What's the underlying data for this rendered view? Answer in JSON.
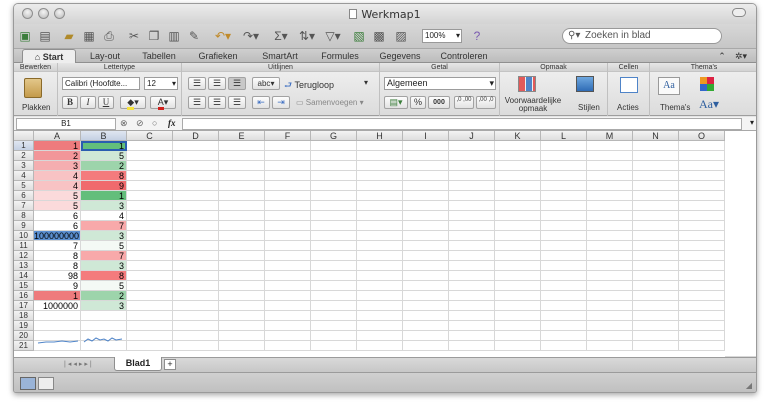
{
  "window": {
    "title": "Werkmap1"
  },
  "toolbar": {
    "zoom": "100%",
    "search_placeholder": "Zoeken in blad"
  },
  "tabs": [
    "Start",
    "Lay-out",
    "Tabellen",
    "Grafieken",
    "SmartArt",
    "Formules",
    "Gegevens",
    "Controleren"
  ],
  "ribbon": {
    "groups": {
      "bewerken": "Bewerken",
      "lettertype": "Lettertype",
      "uitlijnen": "Uitlijnen",
      "getal": "Getal",
      "opmaak": "Opmaak",
      "cellen": "Cellen",
      "themas": "Thema's"
    },
    "plakken": "Plakken",
    "font_name": "Calibri (Hoofdte...",
    "font_size": "12",
    "bold": "B",
    "italic": "I",
    "underline": "U",
    "wrap_text": "Terugloop",
    "merge": "Samenvoegen",
    "abc": "abc",
    "number_format": "Algemeen",
    "percent": "%",
    "thousands": "000",
    "dec_inc": ",0 ,00",
    "dec_dec": ",00 ,0",
    "cond_format": "Voorwaardelijke opmaak",
    "styles": "Stijlen",
    "actions": "Acties",
    "themes": "Thema's",
    "theme_sample": "Aa",
    "font_sample": "Aa"
  },
  "formula_bar": {
    "name_box": "B1",
    "fx": "fx",
    "content": ""
  },
  "grid": {
    "columns": [
      "A",
      "B",
      "C",
      "D",
      "E",
      "F",
      "G",
      "H",
      "I",
      "J",
      "K",
      "L",
      "M",
      "N",
      "O"
    ],
    "rows": [
      "1",
      "2",
      "3",
      "4",
      "5",
      "6",
      "7",
      "8",
      "9",
      "10",
      "11",
      "12",
      "13",
      "14",
      "15",
      "16",
      "17",
      "18",
      "19",
      "20",
      "21"
    ],
    "col_a": [
      "1",
      "2",
      "3",
      "4",
      "4",
      "5",
      "5",
      "6",
      "6",
      "100000000",
      "7",
      "8",
      "8",
      "98",
      "9",
      "1",
      "1000000",
      "",
      "",
      "",
      ""
    ],
    "col_b": [
      "1",
      "5",
      "2",
      "8",
      "9",
      "1",
      "3",
      "4",
      "7",
      "3",
      "5",
      "7",
      "3",
      "8",
      "5",
      "2",
      "3",
      "",
      "",
      "",
      ""
    ],
    "col_a_colors": [
      "#ee7b7d",
      "#f29699",
      "#f5aeb0",
      "#f8c3c4",
      "#f8c3c4",
      "#fbdadb",
      "#fbdadb",
      "#ffffff",
      "#ffffff",
      "#5b8fd1",
      "#ffffff",
      "#ffffff",
      "#ffffff",
      "#ffffff",
      "#ffffff",
      "#ee7b7d",
      "#ffffff",
      "#ffffff",
      "#ffffff",
      "#ffffff",
      "#ffffff"
    ],
    "col_b_colors": [
      "#63be7b",
      "#cfe8d6",
      "#9dd4ab",
      "#f47b7d",
      "#f06a6d",
      "#63be7b",
      "#cfe8d6",
      "#ffffff",
      "#f8a9aa",
      "#cfe8d6",
      "#f4f9f5",
      "#f8a9aa",
      "#cfe8d6",
      "#f47b7d",
      "#f4f9f5",
      "#9dd4ab",
      "#cfe8d6",
      "#ffffff",
      "#ffffff",
      "#ffffff",
      "#ffffff"
    ]
  },
  "sheet_tabs": [
    "Blad1"
  ],
  "sheet_add": "+"
}
